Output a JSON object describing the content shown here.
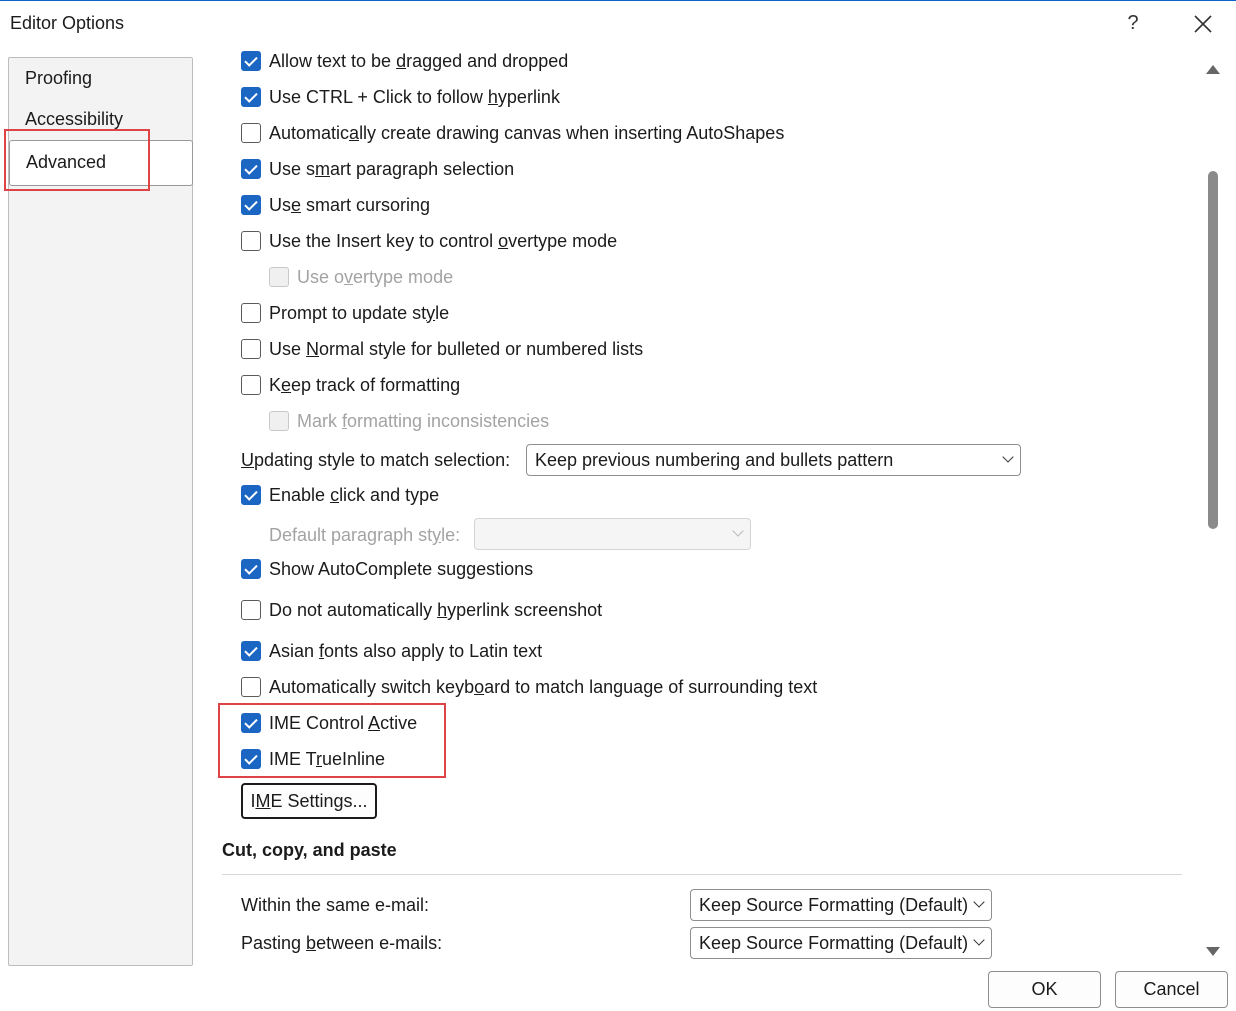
{
  "window": {
    "title": "Editor Options",
    "help": "?"
  },
  "nav": {
    "items": [
      "Proofing",
      "Accessibility",
      "Advanced"
    ]
  },
  "options": {
    "allow_drag": {
      "pre": "Allow text to be ",
      "u": "d",
      "post": "ragged and dropped",
      "checked": true
    },
    "ctrl_click": {
      "pre": "Use CTRL + Click to follow ",
      "u": "h",
      "post": "yperlink",
      "checked": true
    },
    "canvas": {
      "pre": "Automatic",
      "u": "a",
      "post": "lly create drawing canvas when inserting AutoShapes",
      "checked": false
    },
    "smart_para": {
      "pre": "Use s",
      "u": "m",
      "post": "art paragraph selection",
      "checked": true
    },
    "smart_cursor": {
      "pre": "Us",
      "u": "e",
      "post": " smart cursoring",
      "checked": true
    },
    "insert_key": {
      "pre": "Use the Insert key to control ",
      "u": "o",
      "post": "vertype mode",
      "checked": false
    },
    "overtype": {
      "pre": "Use o",
      "u": "v",
      "post": "ertype mode",
      "checked": false
    },
    "prompt_style": {
      "pre": "Prompt to update st",
      "u": "y",
      "post": "le",
      "checked": false
    },
    "normal_style": {
      "pre": "Use ",
      "u": "N",
      "post": "ormal style for bulleted or numbered lists",
      "checked": false
    },
    "track_format": {
      "pre": "K",
      "u": "e",
      "post": "ep track of formatting",
      "checked": false
    },
    "mark_incons": {
      "pre": "Mark ",
      "u": "f",
      "post": "ormatting inconsistencies",
      "checked": false
    },
    "click_type": {
      "pre": "Enable ",
      "u": "c",
      "post": "lick and type",
      "checked": true
    },
    "autocomplete": {
      "pre": "Show AutoComplete suggestions",
      "u": "",
      "post": "",
      "checked": true
    },
    "no_hyperlink": {
      "pre": "Do not automatically ",
      "u": "h",
      "post": "yperlink screenshot",
      "checked": false
    },
    "asian_fonts": {
      "pre": "Asian ",
      "u": "f",
      "post": "onts also apply to Latin text",
      "checked": true
    },
    "switch_kbd": {
      "pre": "Automatically switch keyb",
      "u": "o",
      "post": "ard to match language of surrounding text",
      "checked": false
    },
    "ime_control": {
      "pre": "IME Control ",
      "u": "A",
      "post": "ctive",
      "checked": true
    },
    "ime_trueinline": {
      "pre": "IME T",
      "u": "r",
      "post": "ueInline",
      "checked": true
    }
  },
  "updating_style": {
    "u": "U",
    "label_rest": "pdating style to match selection:",
    "value": "Keep previous numbering and bullets pattern"
  },
  "default_para": {
    "pre": "Default paragraph st",
    "u": "y",
    "post": "le:",
    "value": ""
  },
  "ime_settings": {
    "pre": "I",
    "u": "M",
    "post": "E Settings..."
  },
  "cut_copy": {
    "title": "Cut, copy, and paste",
    "same_email": {
      "label": "Within the same e-mail:",
      "value": "Keep Source Formatting (Default)"
    },
    "between_emails": {
      "pre": "Pasting ",
      "u": "b",
      "post": "etween e-mails:",
      "value": "Keep Source Formatting (Default)"
    }
  },
  "footer": {
    "ok": "OK",
    "cancel": "Cancel"
  },
  "colors": {
    "accent": "#1a66c2",
    "highlight": "#e04343"
  }
}
